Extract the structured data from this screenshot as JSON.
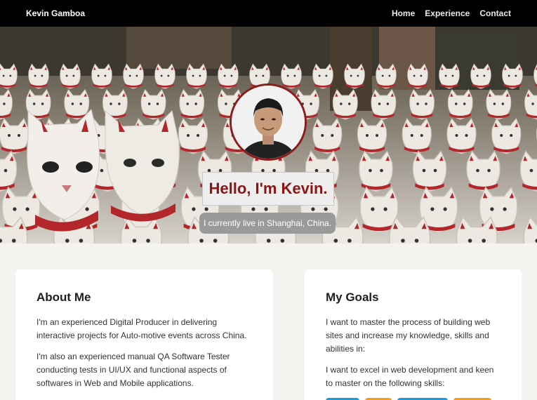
{
  "navbar": {
    "brand": "Kevin Gamboa",
    "links": [
      "Home",
      "Experience",
      "Contact"
    ]
  },
  "hero": {
    "greeting": "Hello, I'm Kevin.",
    "location": "I currently live in Shanghai, China."
  },
  "about": {
    "title": "About Me",
    "paragraphs": [
      "I'm an experienced Digital Producer in delivering interactive projects for Auto-motive events across China.",
      "I'm also an experienced manual QA Software Tester conducting tests in UI/UX and functional aspects of softwares in Web and Mobile applications."
    ]
  },
  "goals": {
    "title": "My Goals",
    "paragraphs": [
      "I want to master the process of building web sites and increase my knowledge, skills and abilities in:",
      "I want to excel in web development and keen to master on the following skills:"
    ]
  },
  "colors": {
    "accent": "#8e1414",
    "skill_badges": [
      "#1e9bd7",
      "#f0a01e",
      "#1e9bd7",
      "#f0a01e"
    ]
  }
}
